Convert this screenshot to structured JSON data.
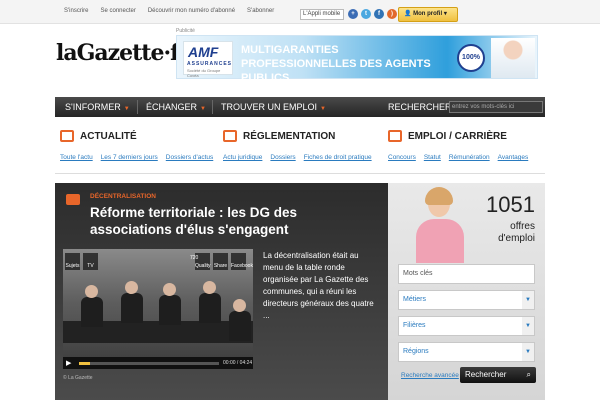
{
  "topbar": {
    "links": [
      "S'inscrire",
      "Se connecter",
      "Découvrir mon numéro d'abonné",
      "S'abonner"
    ],
    "app_label": "L'Appli mobile",
    "profile_label": "Mon profil",
    "social_colors": [
      "#3b6cb5",
      "#4aa8e0",
      "#3173b5",
      "#e2692b"
    ]
  },
  "header": {
    "logo": "laGazette·fr",
    "pub_label": "Publicité",
    "banner": {
      "brand": "AMF",
      "brand_sub": "ASSURANCES",
      "brand_tiny": "Société du Groupe Covéa",
      "headline": "MULTIGARANTIES PROFESSIONNELLES DES AGENTS PUBLICS",
      "badge": "100%"
    }
  },
  "nav": {
    "items": [
      "S'INFORMER",
      "ÉCHANGER",
      "TROUVER UN EMPLOI"
    ],
    "search_label": "RECHERCHER",
    "search_placeholder": "entrez vos mots-clés ici"
  },
  "sections": [
    {
      "title": "ACTUALITÉ",
      "links": [
        "Toute l'actu",
        "Les 7 derniers jours",
        "Dossiers d'actus"
      ]
    },
    {
      "title": "RÉGLEMENTATION",
      "links": [
        "Actu juridique",
        "Dossiers",
        "Fiches de droit pratique"
      ]
    },
    {
      "title": "EMPLOI / CARRIÈRE",
      "links": [
        "Concours",
        "Statut",
        "Rémunération",
        "Avantages"
      ]
    }
  ],
  "feature": {
    "category": "DÉCENTRALISATION",
    "title": "Réforme territoriale : les DG des associations d'élus s'engagent",
    "summary": "La décentralisation était au menu de la table ronde organisée par La Gazette des communes, qui a réuni les directeurs généraux des quatre ...",
    "video": {
      "tools_left": [
        "Sujets",
        "TV"
      ],
      "tools_right": [
        "Quality",
        "Share",
        "Facebook"
      ],
      "quality": "720",
      "time": "00:00 / 04:24",
      "credit": "© La Gazette",
      "progress": 0.08
    }
  },
  "jobs": {
    "count": "1051",
    "label": "offres d'emploi",
    "keywords_placeholder": "Mots clés",
    "selects": [
      "Métiers",
      "Filières",
      "Régions"
    ],
    "advanced_link": "Recherche avancée",
    "search_button": "Rechercher"
  }
}
